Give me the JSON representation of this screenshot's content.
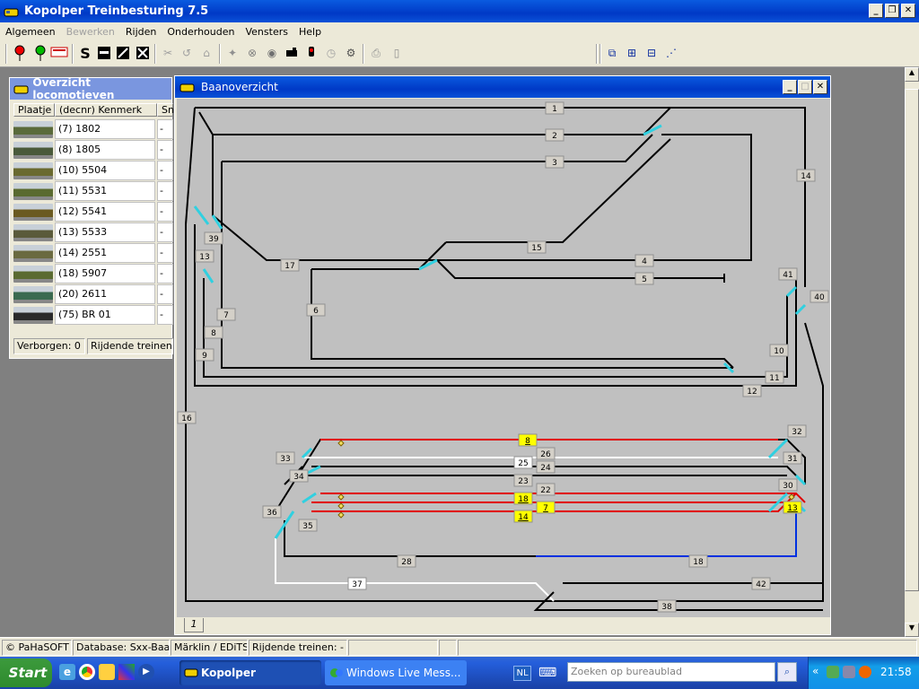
{
  "app": {
    "title": "Kopolper Treinbesturing 7.5"
  },
  "menu": [
    "Algemeen",
    "Bewerken",
    "Rijden",
    "Onderhouden",
    "Vensters",
    "Help"
  ],
  "menu_disabled": [
    false,
    true,
    false,
    false,
    false,
    false
  ],
  "toolbar": {
    "letter_s": "S"
  },
  "loco": {
    "title": "Overzicht locomotieven",
    "headers": [
      "Plaatje",
      "(decnr) Kenmerk",
      "Sn"
    ],
    "rows": [
      {
        "name": "(7) 1802",
        "speed": "-",
        "color": "#5a6a3a"
      },
      {
        "name": "(8) 1805",
        "speed": "-",
        "color": "#4a5a3a"
      },
      {
        "name": "(10) 5504",
        "speed": "-",
        "color": "#6a6a30"
      },
      {
        "name": "(11) 5531",
        "speed": "-",
        "color": "#5a6a30"
      },
      {
        "name": "(12) 5541",
        "speed": "-",
        "color": "#6a5a20"
      },
      {
        "name": "(13) 5533",
        "speed": "-",
        "color": "#5a5a3a"
      },
      {
        "name": "(14) 2551",
        "speed": "-",
        "color": "#6a6a40"
      },
      {
        "name": "(18) 5907",
        "speed": "-",
        "color": "#5a6a30"
      },
      {
        "name": "(20) 2611",
        "speed": "-",
        "color": "#3a6a50"
      },
      {
        "name": "(75) BR 01",
        "speed": "-",
        "color": "#2a2a2a"
      }
    ],
    "hidden": "Verborgen: 0",
    "driving": "Rijdende treinen: -"
  },
  "baan": {
    "title": "Baanoverzicht",
    "tab": "1",
    "blocks": [
      {
        "id": "1",
        "state": "normal"
      },
      {
        "id": "2",
        "state": "normal"
      },
      {
        "id": "3",
        "state": "normal"
      },
      {
        "id": "4",
        "state": "normal"
      },
      {
        "id": "5",
        "state": "normal"
      },
      {
        "id": "6",
        "state": "normal"
      },
      {
        "id": "7",
        "state": "normal"
      },
      {
        "id": "8",
        "state": "occupied"
      },
      {
        "id": "9",
        "state": "normal"
      },
      {
        "id": "10",
        "state": "normal"
      },
      {
        "id": "11",
        "state": "normal"
      },
      {
        "id": "12",
        "state": "normal"
      },
      {
        "id": "13",
        "state": "normal"
      },
      {
        "id": "14",
        "state": "normal"
      },
      {
        "id": "15",
        "state": "normal"
      },
      {
        "id": "16",
        "state": "normal"
      },
      {
        "id": "17",
        "state": "normal"
      },
      {
        "id": "18",
        "state": "normal"
      },
      {
        "id": "22",
        "state": "normal"
      },
      {
        "id": "23",
        "state": "normal"
      },
      {
        "id": "24",
        "state": "normal"
      },
      {
        "id": "25",
        "state": "free"
      },
      {
        "id": "26",
        "state": "normal"
      },
      {
        "id": "28",
        "state": "normal"
      },
      {
        "id": "30",
        "state": "normal"
      },
      {
        "id": "31",
        "state": "normal"
      },
      {
        "id": "32",
        "state": "normal"
      },
      {
        "id": "33",
        "state": "normal"
      },
      {
        "id": "34",
        "state": "normal"
      },
      {
        "id": "35",
        "state": "normal"
      },
      {
        "id": "36",
        "state": "normal"
      },
      {
        "id": "37",
        "state": "free"
      },
      {
        "id": "38",
        "state": "normal"
      },
      {
        "id": "39",
        "state": "normal"
      },
      {
        "id": "40",
        "state": "normal"
      },
      {
        "id": "41",
        "state": "normal"
      },
      {
        "id": "42",
        "state": "normal"
      }
    ],
    "trains": [
      {
        "label": "8",
        "track": "8"
      },
      {
        "label": "18",
        "track": "22"
      },
      {
        "label": "7",
        "track": "22"
      },
      {
        "label": "14",
        "track": "23"
      },
      {
        "label": "13",
        "track": "22"
      }
    ]
  },
  "status": {
    "company": "© PaHaSOFT",
    "database": "Database: Sxx-Baan",
    "system": "Märklin / EDiTS",
    "trains": "Rijdende treinen: -"
  },
  "taskbar": {
    "start": "Start",
    "tasks": [
      "Kopolper",
      "Windows Live Mess..."
    ],
    "lang": "NL",
    "search_placeholder": "Zoeken op bureaublad",
    "time": "21:58"
  },
  "colors": {
    "occupied": "#e00000",
    "reserved": "#0030e0",
    "free": "#ffffff",
    "turnout": "#30d0e0",
    "train": "#ffff00"
  }
}
